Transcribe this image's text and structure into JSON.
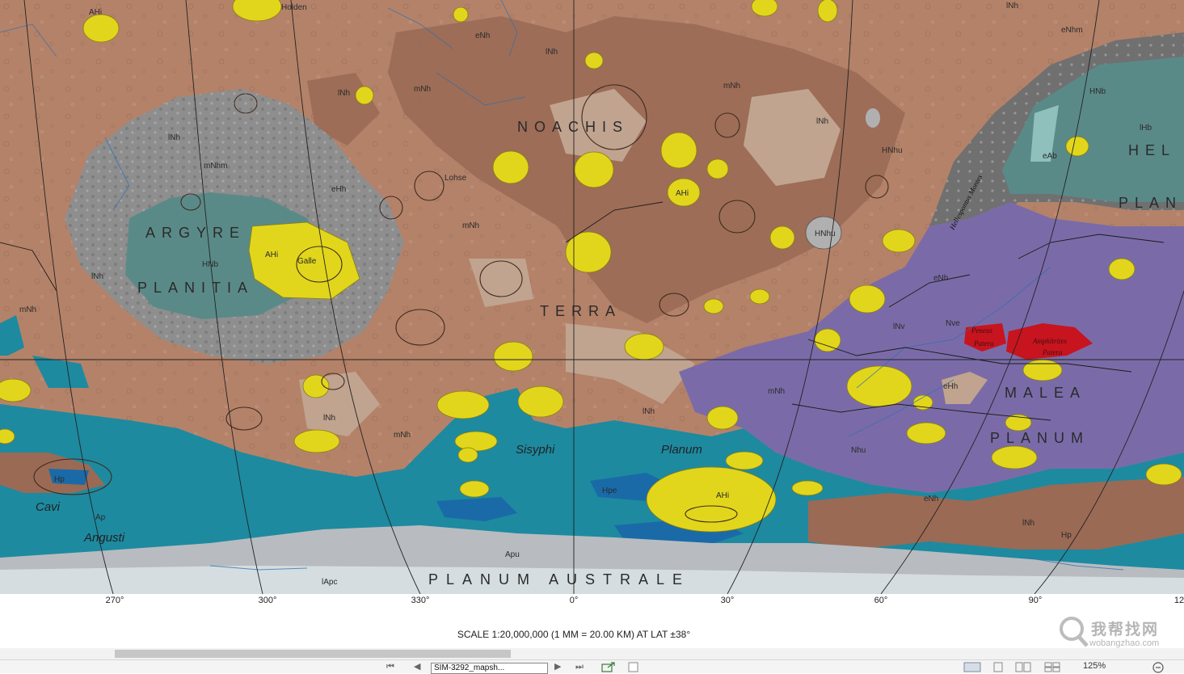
{
  "map": {
    "region_labels": {
      "argyre": "ARGYRE",
      "planitia": "PLANITIA",
      "noachis": "NOACHIS",
      "terra": "TERRA",
      "malea": "MALEA",
      "malea_planum": "PLANUM",
      "hel": "HEL",
      "plan": "PLAN",
      "planum_australe": "PLANUM AUSTRALE",
      "sisyphi": "Sisyphi",
      "planum": "Planum",
      "cavi": "Cavi",
      "angusti": "Angusti"
    },
    "unit_labels": {
      "AHi_1": "AHi",
      "AHi_2": "AHi",
      "AHi_3": "AHi",
      "AHi_4": "AHi",
      "mNh_1": "mNh",
      "mNh_2": "mNh",
      "mNh_3": "mNh",
      "mNh_4": "mNh",
      "lNh_1": "lNh",
      "lNh_2": "lNh",
      "lNh_3": "lNh",
      "lNh_4": "lNh",
      "lNh_5": "lNh",
      "lNh_6": "lNh",
      "eNh_1": "eNh",
      "eNh_2": "eNh",
      "eNh_3": "eNh",
      "eNhm": "eNhm",
      "mNhm": "mNhm",
      "HNhu": "HNhu",
      "HNhu_2": "HNhu",
      "HNb_1": "HNb",
      "HNb_2": "HNb",
      "lHb": "lHb",
      "eAb": "eAb",
      "eHh_1": "eHh",
      "eHh_2": "eHh",
      "lNv": "lNv",
      "Nve": "Nve",
      "Nhu": "Nhu",
      "Hp_1": "Hp",
      "Hp_2": "Hp",
      "Ap": "Ap",
      "Hpe": "Hpe",
      "Apu": "Apu",
      "lApc": "lApc",
      "lNh_b": "lNh",
      "lNh_c": "lNh",
      "lNh_d": "lNh",
      "lNh_e": "lNh",
      "lNh_f": "lNh"
    },
    "feature_labels": {
      "holden": "Holden",
      "lohse": "Lohse",
      "galle": "Galle",
      "peneus_1": "Peneus",
      "peneus_2": "Patera",
      "amphitrites_1": "Amphitrites",
      "amphitrites_2": "Patera",
      "hellespontus": "Hellespontus Montes"
    },
    "colors": {
      "noachian_terrain": "#b48269",
      "dark_noachian": "#9a6a55",
      "highland_tan": "#c0a48f",
      "argyre_rim": "#8e8e8e",
      "planitia_teal": "#5a8a88",
      "crater_yellow": "#e2d61c",
      "volcanic_purple": "#7a6ba8",
      "patera_red": "#c8141e",
      "polar_teal": "#1d8aa0",
      "deep_blue": "#1a6aa8",
      "polar_cap_grey": "#b8bcc0"
    }
  },
  "axis": {
    "longitudes": [
      "270°",
      "300°",
      "330°",
      "0°",
      "30°",
      "60°",
      "90°",
      "12"
    ]
  },
  "scale_text": "SCALE 1:20,000,000 (1 MM = 20.00 KM) AT LAT ±38°",
  "toolbar": {
    "page_selector": "SIM-3292_mapsh...",
    "zoom": "125%",
    "nav_first": "⏮",
    "nav_prev": "◀",
    "nav_next": "▶",
    "nav_last": "⏭"
  },
  "watermark": {
    "text": "我帮找网",
    "url": "wobangzhao.com"
  }
}
